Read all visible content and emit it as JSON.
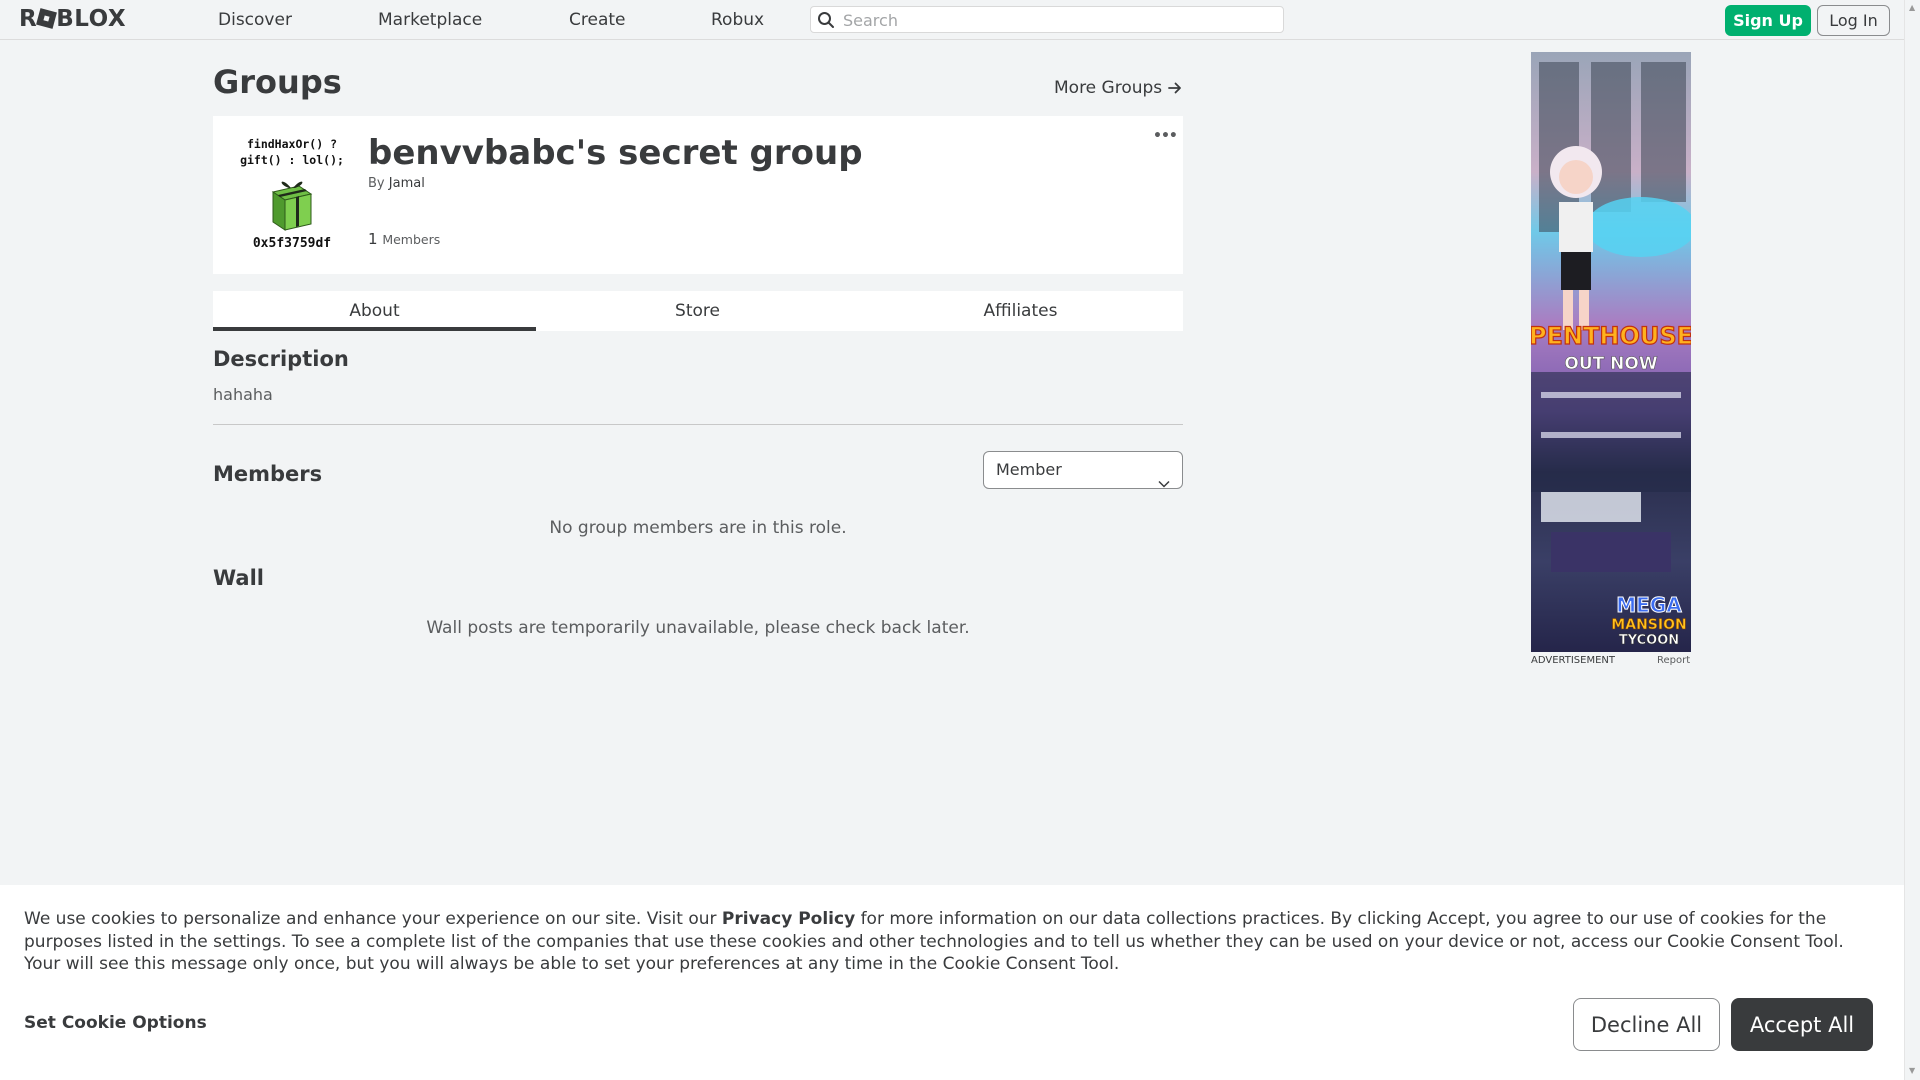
{
  "nav": {
    "logo": "ROBLOX",
    "links": [
      "Discover",
      "Marketplace",
      "Create",
      "Robux"
    ],
    "search_placeholder": "Search",
    "signup_label": "Sign Up",
    "login_label": "Log In"
  },
  "page": {
    "title": "Groups",
    "more_groups": "More Groups"
  },
  "group": {
    "emblem_top": "findHaxOr() ?\ngift() : lol();",
    "emblem_bottom": "0x5f3759df",
    "name": "benvvbabc's secret group",
    "by_prefix": "By",
    "owner": "Jamal",
    "member_count": "1",
    "member_label": "Members"
  },
  "tabs": [
    "About",
    "Store",
    "Affiliates"
  ],
  "active_tab": "About",
  "about": {
    "description_heading": "Description",
    "description_text": "hahaha",
    "members_heading": "Members",
    "role_selected": "Member",
    "no_members_msg": "No group members are in this role.",
    "wall_heading": "Wall",
    "wall_msg": "Wall posts are temporarily unavailable, please check back later."
  },
  "ad": {
    "label": "ADVERTISEMENT",
    "report": "Report",
    "text1": "PENTHOUSE",
    "text2": "OUT NOW",
    "text3": "MEGA",
    "text4": "MANSION",
    "text5": "TYCOON"
  },
  "cookie": {
    "text_before": "We use cookies to personalize and enhance your experience on our site. Visit our ",
    "privacy_link": "Privacy Policy",
    "text_after": " for more information on our data collections practices. By clicking Accept, you agree to our use of cookies for the purposes listed in the settings. To see a complete list of the companies that use these cookies and other technologies and to tell us whether they can be used on your device or not, access our Cookie Consent Tool. Your will see this message only once, but you will always be able to set your preferences at any time in the Cookie Consent Tool.",
    "set_options": "Set Cookie Options",
    "decline": "Decline All",
    "accept": "Accept All"
  },
  "colors": {
    "signup": "#00b06f",
    "text": "#393b3d",
    "background": "#f2f4f5"
  }
}
